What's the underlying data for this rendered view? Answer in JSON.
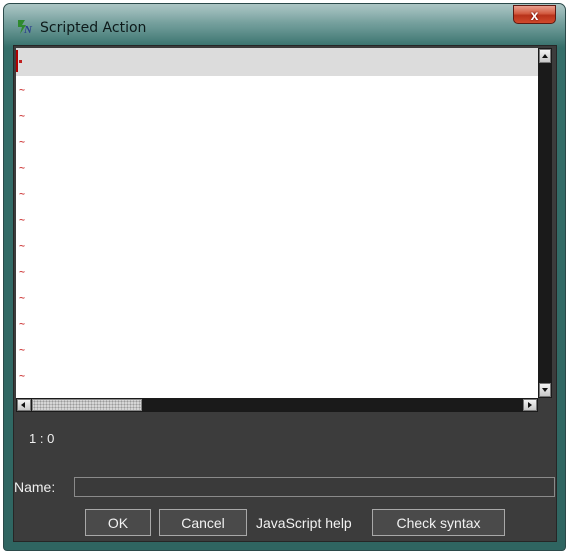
{
  "window": {
    "title": "Scripted Action",
    "close_symbol": "x"
  },
  "editor": {
    "line_marker": "~",
    "line_count": 13
  },
  "status": {
    "cursor_position": "1 : 0"
  },
  "name_field": {
    "label": "Name:",
    "value": ""
  },
  "buttons": {
    "ok": "OK",
    "cancel": "Cancel",
    "javascript_help": "JavaScript help",
    "check_syntax": "Check syntax"
  },
  "colors": {
    "dialog_background": "#3c3c3c",
    "titlebar_accent": "#5d8f8c",
    "close_button": "#c8442b",
    "line_marker": "#c00000"
  },
  "icons": {
    "app": "app-logo-icon",
    "close": "close-icon"
  }
}
